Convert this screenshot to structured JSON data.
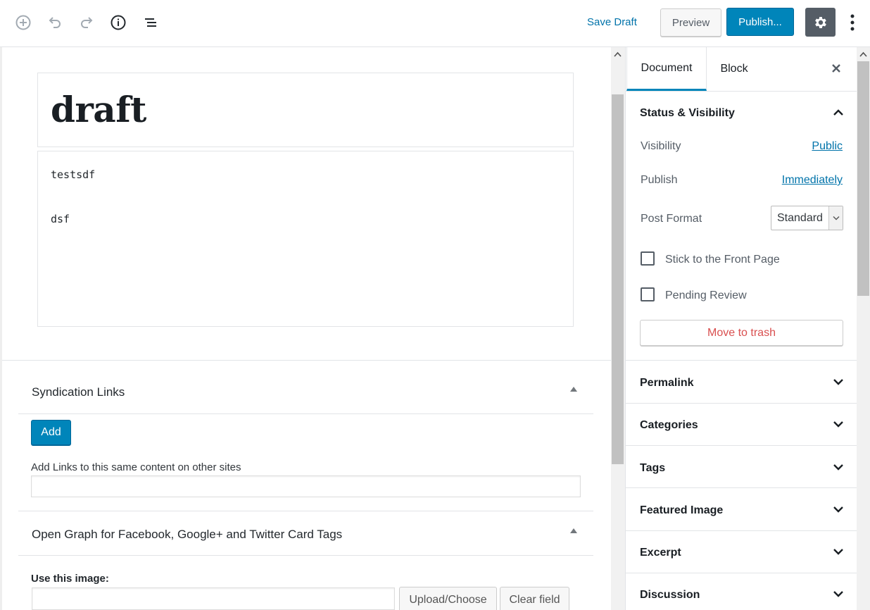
{
  "toolbar": {
    "save_draft": "Save Draft",
    "preview": "Preview",
    "publish": "Publish...",
    "icons": [
      "add-block-icon",
      "undo-icon",
      "redo-icon",
      "info-icon",
      "outline-icon",
      "gear-icon",
      "more-vertical-icon"
    ]
  },
  "editor": {
    "title": "draft",
    "body_lines": [
      "testsdf",
      "dsf"
    ]
  },
  "metaboxes": {
    "syndication": {
      "title": "Syndication Links",
      "add_label": "Add",
      "field_label": "Add Links to this same content on other sites",
      "field_value": ""
    },
    "opengraph": {
      "title": "Open Graph for Facebook, Google+ and Twitter Card Tags",
      "image_label": "Use this image:",
      "image_value": "",
      "upload_label": "Upload/Choose",
      "clear_label": "Clear field"
    }
  },
  "sidebar": {
    "tabs": [
      "Document",
      "Block"
    ],
    "active_tab": "Document",
    "status": {
      "title": "Status & Visibility",
      "visibility_label": "Visibility",
      "visibility_value": "Public",
      "publish_label": "Publish",
      "publish_value": "Immediately",
      "format_label": "Post Format",
      "format_value": "Standard",
      "sticky_label": "Stick to the Front Page",
      "sticky_checked": false,
      "pending_label": "Pending Review",
      "pending_checked": false,
      "trash_label": "Move to trash"
    },
    "panels": [
      "Permalink",
      "Categories",
      "Tags",
      "Featured Image",
      "Excerpt",
      "Discussion"
    ]
  },
  "colors": {
    "accent": "#0085ba",
    "link": "#0073aa",
    "danger": "#d94f4f",
    "settings_bg": "#555d66"
  }
}
